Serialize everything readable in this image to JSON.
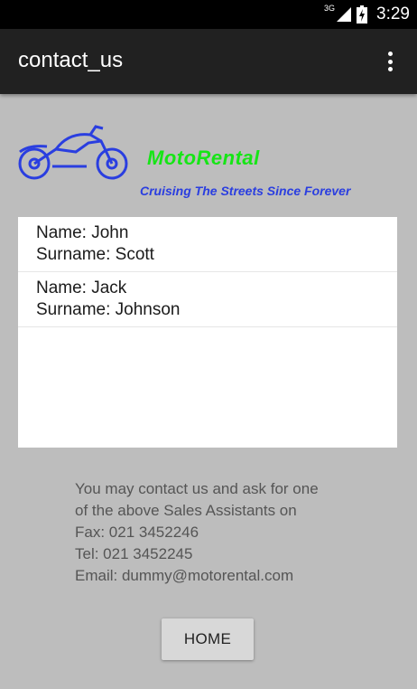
{
  "status_bar": {
    "network_label": "3G",
    "time": "3:29"
  },
  "app_bar": {
    "title": "contact_us",
    "menu_icon": "overflow-menu-icon"
  },
  "logo": {
    "brand": "MotoRental",
    "slogan": "Cruising The Streets Since Forever",
    "icon": "motorcycle-icon",
    "colors": {
      "brand": "#16e516",
      "slogan": "#2a3ee0",
      "bike": "#2a3ee0"
    }
  },
  "assistants": [
    {
      "name": "Name: John",
      "surname": "Surname: Scott"
    },
    {
      "name": "Name: Jack",
      "surname": "Surname: Johnson"
    }
  ],
  "contact": {
    "line1": "You may contact us and ask for one",
    "line2": "of the above Sales Assistants on",
    "fax": "Fax: 021 3452246",
    "tel": "Tel: 021 3452245",
    "email": "Email: dummy@motorental.com"
  },
  "home_button": {
    "label": "HOME"
  }
}
